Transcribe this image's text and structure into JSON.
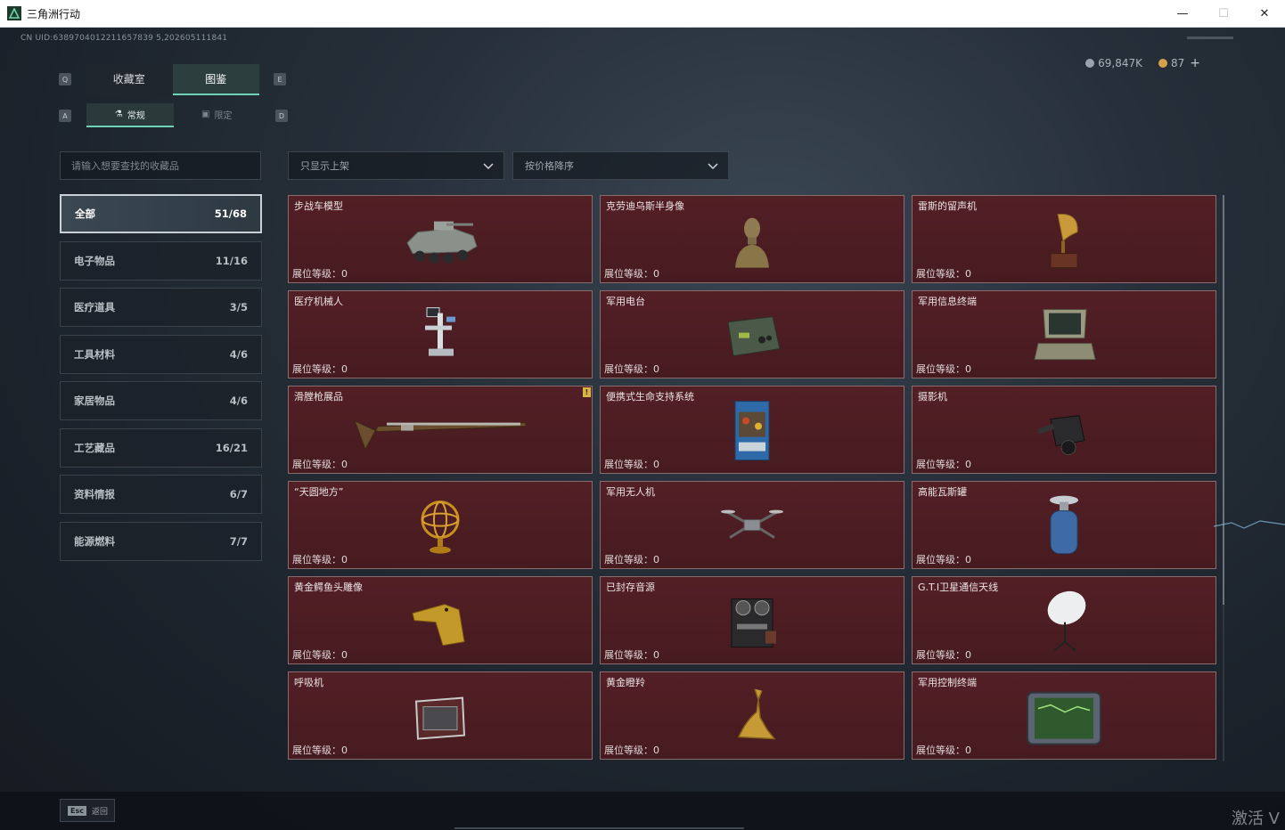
{
  "window": {
    "title": "三角洲行动",
    "minimize": "—",
    "maximize": "☐",
    "close": "✕"
  },
  "header": {
    "uid": "CN UID:6389704012211657839 5,202605111841",
    "currency_a": "69,847K",
    "currency_b": "87",
    "plus": "+",
    "currency_a_color": "#9aa3ab",
    "currency_b_color": "#d4a24a"
  },
  "tabs": {
    "left_key": "Q",
    "right_key": "E",
    "items": [
      {
        "label": "收藏室",
        "active": false
      },
      {
        "label": "图鉴",
        "active": true
      }
    ]
  },
  "subtabs": {
    "left_key": "A",
    "right_key": "D",
    "items": [
      {
        "label": "常规",
        "icon": "flask-icon",
        "active": true
      },
      {
        "label": "限定",
        "icon": "image-icon",
        "active": false
      }
    ]
  },
  "search": {
    "placeholder": "请输入想要查找的收藏品"
  },
  "filters": {
    "shelf": "只显示上架",
    "sort": "按价格降序"
  },
  "categories": [
    {
      "label": "全部",
      "count": "51/68",
      "active": true
    },
    {
      "label": "电子物品",
      "count": "11/16",
      "active": false
    },
    {
      "label": "医疗道具",
      "count": "3/5",
      "active": false
    },
    {
      "label": "工具材料",
      "count": "4/6",
      "active": false
    },
    {
      "label": "家居物品",
      "count": "4/6",
      "active": false
    },
    {
      "label": "工艺藏品",
      "count": "16/21",
      "active": false
    },
    {
      "label": "资料情报",
      "count": "6/7",
      "active": false
    },
    {
      "label": "能源燃料",
      "count": "7/7",
      "active": false
    }
  ],
  "items": [
    {
      "name": "步战车模型",
      "level": "展位等级：0",
      "icon": "armored-vehicle-icon"
    },
    {
      "name": "克劳迪乌斯半身像",
      "level": "展位等级：0",
      "icon": "bust-icon"
    },
    {
      "name": "雷斯的留声机",
      "level": "展位等级：0",
      "icon": "gramophone-icon"
    },
    {
      "name": "医疗机械人",
      "level": "展位等级：0",
      "icon": "medical-robot-icon"
    },
    {
      "name": "军用电台",
      "level": "展位等级：0",
      "icon": "radio-icon"
    },
    {
      "name": "军用信息终端",
      "level": "展位等级：0",
      "icon": "rugged-terminal-icon"
    },
    {
      "name": "滑膛枪展品",
      "level": "展位等级：0",
      "icon": "musket-icon",
      "badge": "!"
    },
    {
      "name": "便携式生命支持系统",
      "level": "展位等级：0",
      "icon": "life-support-icon"
    },
    {
      "name": "摄影机",
      "level": "展位等级：0",
      "icon": "camera-icon"
    },
    {
      "name": "“天圆地方”",
      "level": "展位等级：0",
      "icon": "armillary-sphere-icon"
    },
    {
      "name": "军用无人机",
      "level": "展位等级：0",
      "icon": "drone-icon"
    },
    {
      "name": "高能瓦斯罐",
      "level": "展位等级：0",
      "icon": "gas-canister-icon"
    },
    {
      "name": "黄金鳄鱼头雕像",
      "level": "展位等级：0",
      "icon": "crocodile-statue-icon"
    },
    {
      "name": "已封存音源",
      "level": "展位等级：0",
      "icon": "reel-recorder-icon"
    },
    {
      "name": "G.T.I卫星通信天线",
      "level": "展位等级：0",
      "icon": "satellite-dish-icon"
    },
    {
      "name": "呼吸机",
      "level": "展位等级：0",
      "icon": "ventilator-icon"
    },
    {
      "name": "黄金瞪羚",
      "level": "展位等级：0",
      "icon": "gazelle-statue-icon"
    },
    {
      "name": "军用控制终端",
      "level": "展位等级：0",
      "icon": "control-terminal-icon"
    }
  ],
  "footer": {
    "esc": "Esc",
    "back": "返回",
    "activate": "激活 V"
  }
}
